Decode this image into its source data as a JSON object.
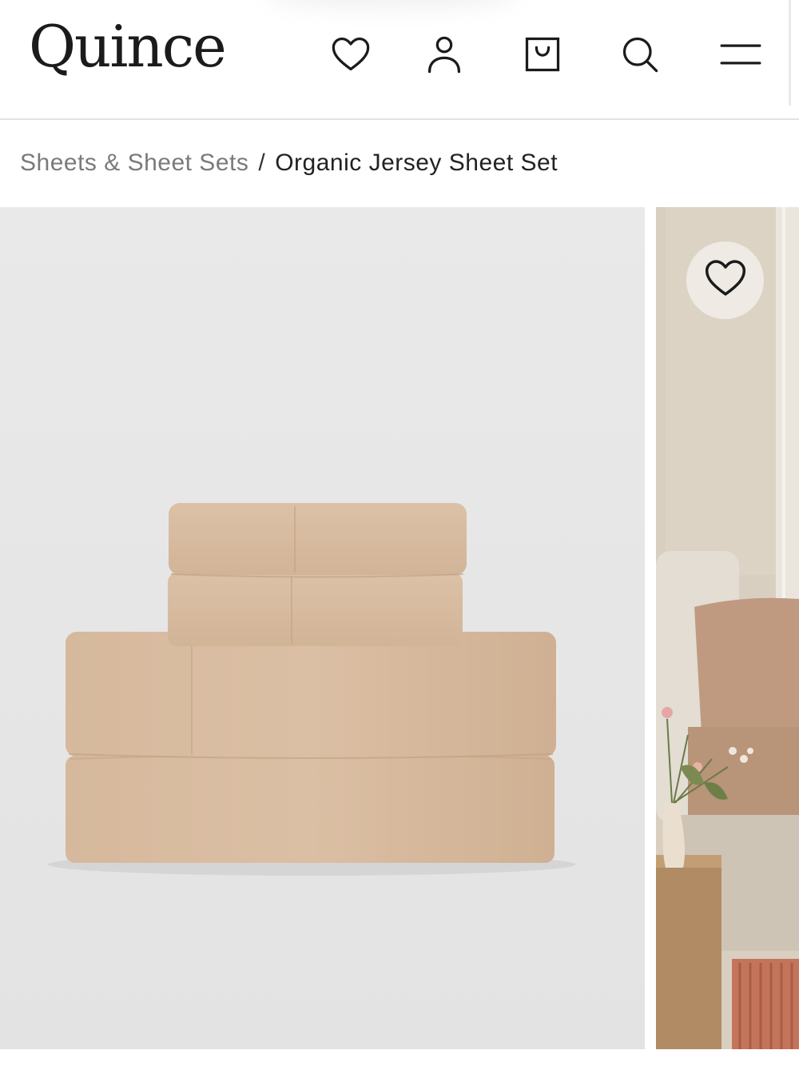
{
  "header": {
    "logo": "Quince",
    "icons": [
      "heart-icon",
      "user-icon",
      "bag-icon",
      "search-icon",
      "menu-icon"
    ]
  },
  "breadcrumb": {
    "parent": "Sheets & Sheet Sets",
    "separator": "/",
    "current": "Organic Jersey Sheet Set"
  },
  "gallery": {
    "main_image": "folded sheet set",
    "side_image": "bedroom lifestyle",
    "favorite_icon": "heart-icon"
  },
  "colors": {
    "sheet": "#d9bca1",
    "background": "#e7e7e7"
  }
}
